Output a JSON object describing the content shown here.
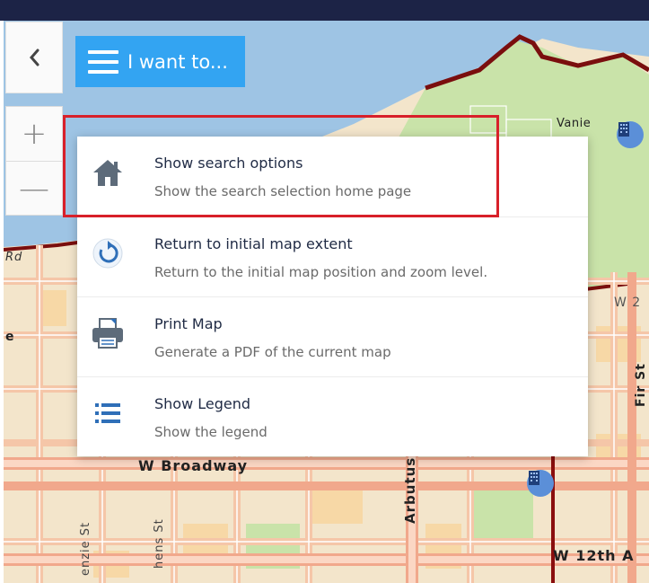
{
  "toolbar": {
    "back_icon": "chevron-left-icon",
    "zoom_in_label": "+",
    "zoom_out_label": "—",
    "i_want_to_label": "I want to..."
  },
  "menu": {
    "items": [
      {
        "icon": "home-icon",
        "title": "Show search options",
        "description": "Show the search selection home page"
      },
      {
        "icon": "reset-extent-icon",
        "title": "Return to initial map extent",
        "description": "Return to the initial map position and zoom level."
      },
      {
        "icon": "printer-icon",
        "title": "Print Map",
        "description": "Generate a PDF of the current map"
      },
      {
        "icon": "list-icon",
        "title": "Show Legend",
        "description": "Show the legend"
      }
    ]
  },
  "map": {
    "labels": {
      "broadway": "W Broadway",
      "w12th": "W 12th A",
      "vanier": "Vanie",
      "w2": "W 2",
      "rd": "Rd",
      "e": "e",
      "arbutus": "Arbutus St",
      "fir": "Fir St",
      "kenzie": "enzie St",
      "hens": "hens St"
    }
  },
  "colors": {
    "topbar": "#1c2346",
    "button_blue": "#33a4f2",
    "highlight_red": "#d8202a",
    "water": "#9ec4e4",
    "park": "#c9e3a9",
    "land": "#f3e5cb",
    "road": "#f5c6a8",
    "boundary": "#7a0e0e"
  }
}
